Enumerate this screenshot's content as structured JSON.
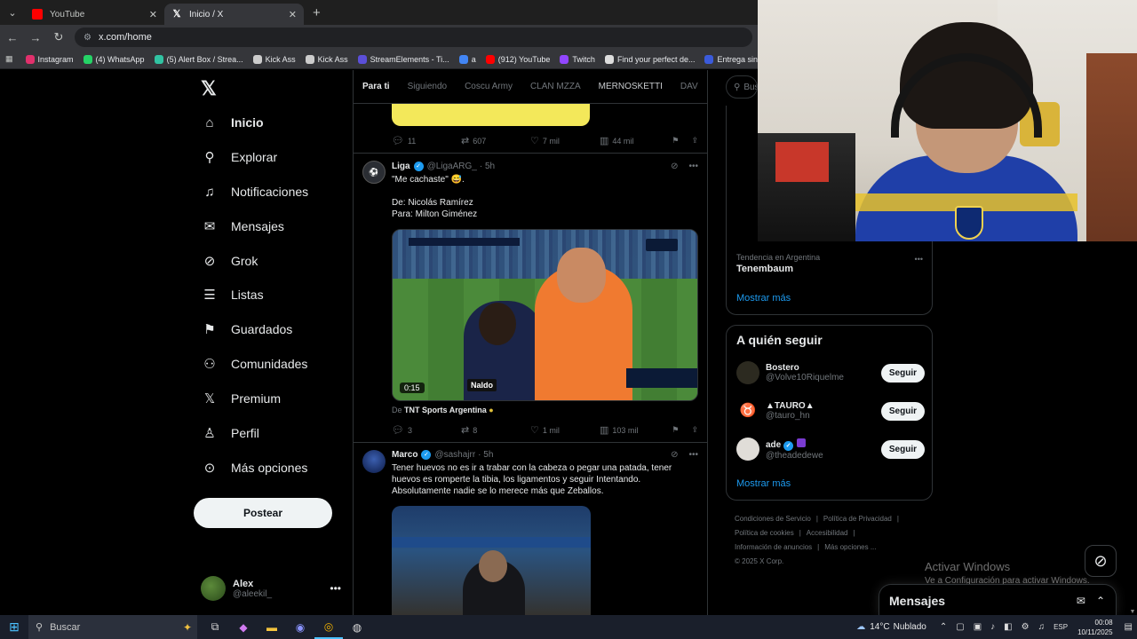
{
  "browser": {
    "tabs": [
      {
        "title": "YouTube",
        "active": false
      },
      {
        "title": "Inicio / X",
        "active": true
      }
    ],
    "url": "x.com/home",
    "bookmarks": [
      {
        "label": "Instagram",
        "color": "#e1306c"
      },
      {
        "label": "(4) WhatsApp",
        "color": "#25d366"
      },
      {
        "label": "(5) Alert Box / Strea...",
        "color": "#31c3a2"
      },
      {
        "label": "Kick Ass",
        "color": "#cccccc"
      },
      {
        "label": "Kick Ass",
        "color": "#cccccc"
      },
      {
        "label": "StreamElements - Ti...",
        "color": "#5b4fd9"
      },
      {
        "label": "a",
        "color": "#4285f4"
      },
      {
        "label": "(912) YouTube",
        "color": "#ff0000"
      },
      {
        "label": "Twitch",
        "color": "#9146ff"
      },
      {
        "label": "Find your perfect de...",
        "color": "#dddddd"
      },
      {
        "label": "Entrega sin contact...",
        "color": "#3b5bdb"
      }
    ]
  },
  "nav": {
    "items": [
      {
        "label": "Inicio",
        "icon": "home-icon",
        "glyph": "⌂"
      },
      {
        "label": "Explorar",
        "icon": "search-icon",
        "glyph": "⚲"
      },
      {
        "label": "Notificaciones",
        "icon": "bell-icon",
        "glyph": "🔔"
      },
      {
        "label": "Mensajes",
        "icon": "envelope-icon",
        "glyph": "✉"
      },
      {
        "label": "Grok",
        "icon": "grok-icon",
        "glyph": "⊘"
      },
      {
        "label": "Listas",
        "icon": "list-icon",
        "glyph": "☰"
      },
      {
        "label": "Guardados",
        "icon": "bookmark-icon",
        "glyph": "⚑"
      },
      {
        "label": "Comunidades",
        "icon": "people-icon",
        "glyph": "👥"
      },
      {
        "label": "Premium",
        "icon": "x-icon",
        "glyph": "𝕏"
      },
      {
        "label": "Perfil",
        "icon": "person-icon",
        "glyph": "👤"
      },
      {
        "label": "Más opciones",
        "icon": "more-circle-icon",
        "glyph": "⋯"
      }
    ],
    "post_label": "Postear",
    "account": {
      "name": "Alex",
      "handle": "@aleekil_"
    }
  },
  "feed": {
    "tabs": [
      "Para ti",
      "Siguiendo",
      "Coscu Army",
      "CLAN MZZA",
      "MERNOSKETTI",
      "DAV"
    ],
    "prev_actions": {
      "replies": "11",
      "reposts": "607",
      "likes": "7 mil",
      "views": "44 mil"
    },
    "tweet1": {
      "name": "Liga",
      "handle": "@LigaARG_",
      "time": "· 5h",
      "text": "\"Me cachaste\" 😅.\n\nDe: Nicolás Ramírez\nPara: Milton Giménez",
      "video_duration": "0:15",
      "video_sponsor": "Naldo",
      "from_prefix": "De",
      "from_source": "TNT Sports Argentina",
      "actions": {
        "replies": "3",
        "reposts": "8",
        "likes": "1 mil",
        "views": "103 mil"
      }
    },
    "tweet2": {
      "name": "Marco",
      "handle": "@sashajrr",
      "time": "· 5h",
      "text": "Tener huevos no es ir a trabar con la cabeza o pegar una patada, tener huevos es romperte la tibia, los ligamentos y seguir Intentando. Absolutamente nadie se lo merece más que Zeballos."
    }
  },
  "sidebar": {
    "search_placeholder": "Bus",
    "trends": [
      {
        "category": "Tendencia en Argentina",
        "title": "Tenembaum",
        "count": ""
      }
    ],
    "show_more": "Mostrar más",
    "who_title": "A quién seguir",
    "who": [
      {
        "name": "Bostero",
        "handle": "@Volve10Riquelme",
        "follow": "Seguir",
        "avatar_color": "#2c2a20"
      },
      {
        "name": "▲TAURO▲",
        "handle": "@tauro_hn",
        "follow": "Seguir",
        "avatar_color": "#000000"
      },
      {
        "name": "ade",
        "handle": "@theadedewe",
        "follow": "Seguir",
        "avatar_color": "#e0ddd8"
      }
    ],
    "footer": [
      "Condiciones de Servicio",
      "Política de Privacidad",
      "Política de cookies",
      "Accesibilidad",
      "Información de anuncios",
      "Más opciones ...",
      "© 2025 X Corp."
    ]
  },
  "overlay": {
    "activate_title": "Activar Windows",
    "activate_sub": "Ve a Configuración para activar Windows.",
    "messages_title": "Mensajes"
  },
  "taskbar": {
    "search_placeholder": "Buscar",
    "weather_temp": "14°C",
    "weather_desc": "Nublado",
    "language": "ESP",
    "time": "00:08",
    "date": "10/11/2025"
  }
}
